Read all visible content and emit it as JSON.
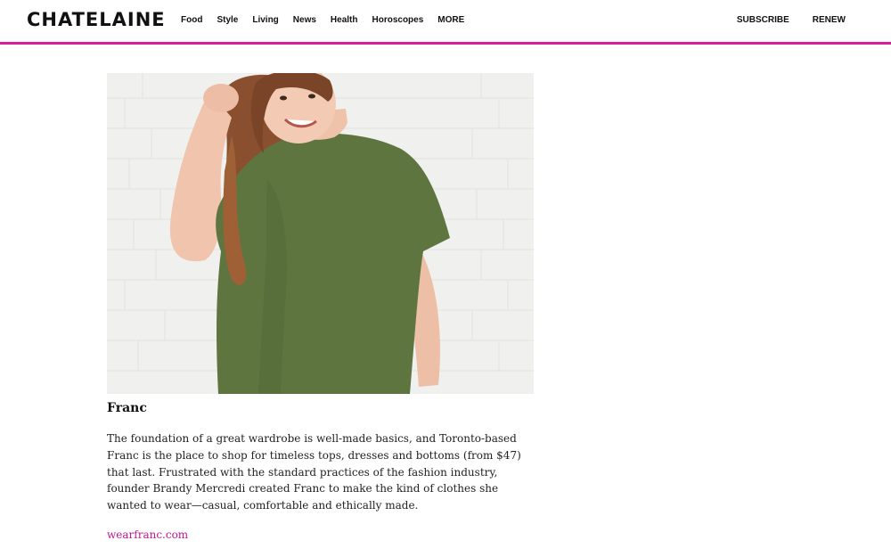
{
  "header": {
    "logo": "CHATELAINE",
    "nav": [
      "Food",
      "Style",
      "Living",
      "News",
      "Health",
      "Horoscopes",
      "MORE"
    ],
    "subscribe": "SUBSCRIBE",
    "renew": "RENEW",
    "accent_color": "#d61f9a"
  },
  "article": {
    "image_icon": "photo-woman-green-tshirt",
    "title": "Franc",
    "body": "The foundation of a great wardrobe is well-made basics, and Toronto-based Franc is the place to shop for timeless tops, dresses and bottoms (from $47) that last. Frustrated with the standard practices of the fashion industry, founder Brandy Mercredi created Franc to make the kind of clothes she wanted to wear—casual, comfortable and ethically made.",
    "link": "wearfranc.com",
    "link_color": "#c2198f"
  }
}
